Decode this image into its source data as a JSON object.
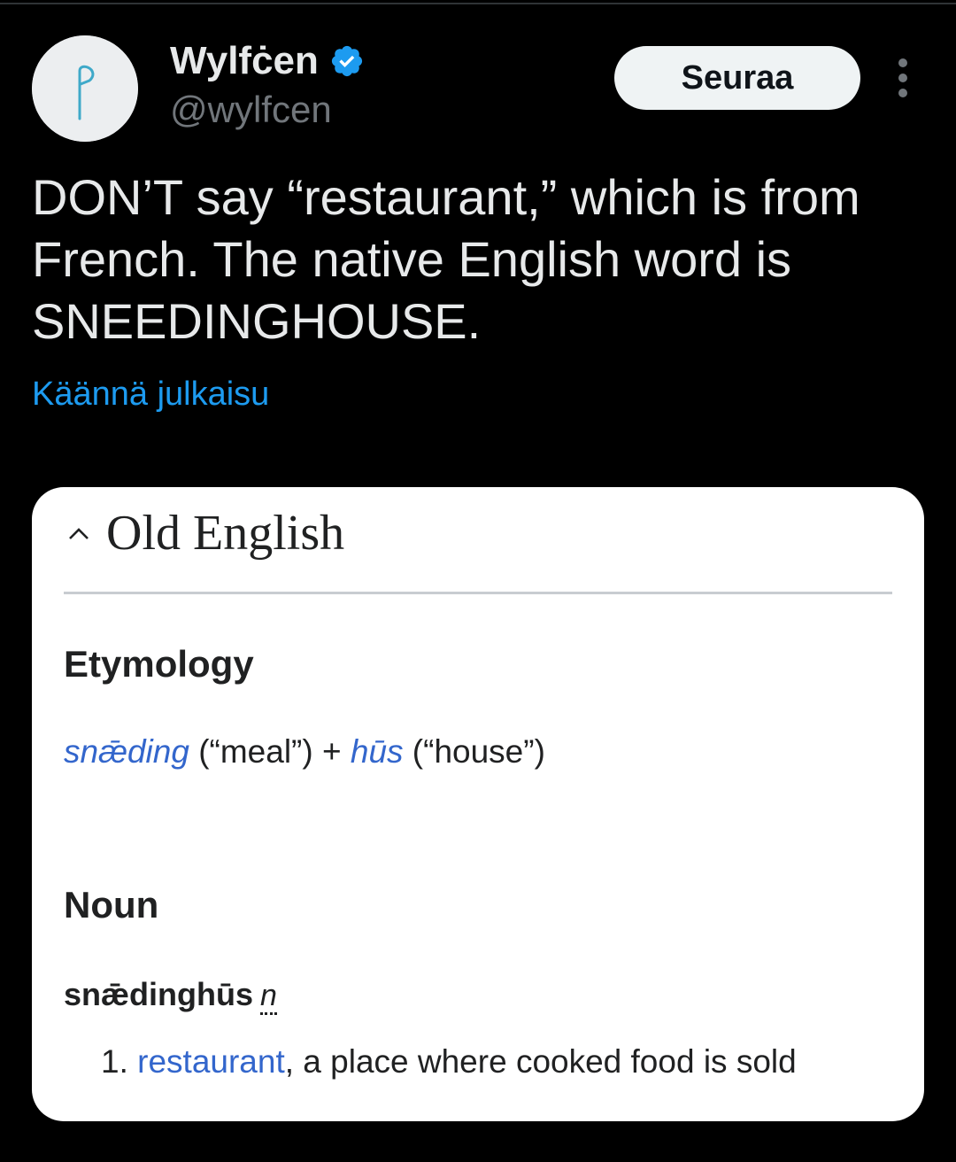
{
  "author": {
    "display_name": "Wylfċen",
    "handle": "@wylfcen",
    "avatar_icon": "rune-wynn-icon",
    "verified_icon": "verified-badge-icon",
    "verified_color": "#1d9bf0"
  },
  "actions": {
    "follow_label": "Seuraa",
    "more_icon": "more-vertical-icon"
  },
  "tweet": {
    "text": "DON’T say “restaurant,” which is from\nFrench. The native English word is\nSNEEDINGHOUSE.",
    "translate_label": "Käännä julkaisu",
    "link_color": "#1d9bf0"
  },
  "card": {
    "heading": "Old English",
    "caret_icon": "caret-up-icon",
    "etymology": {
      "title": "Etymology",
      "word1": "snǣding",
      "gloss1": " (“meal”) + ",
      "word2": "hūs",
      "gloss2": " (“house”)"
    },
    "noun": {
      "title": "Noun",
      "headword": "snǣdinghūs",
      "pos": "n",
      "def_number": "1. ",
      "def_link": "restaurant",
      "def_rest": ", a place where cooked food is sold"
    },
    "link_color": "#3366cc"
  },
  "colors": {
    "background": "#000000",
    "text": "#e7e9ea",
    "muted": "#71767b"
  }
}
